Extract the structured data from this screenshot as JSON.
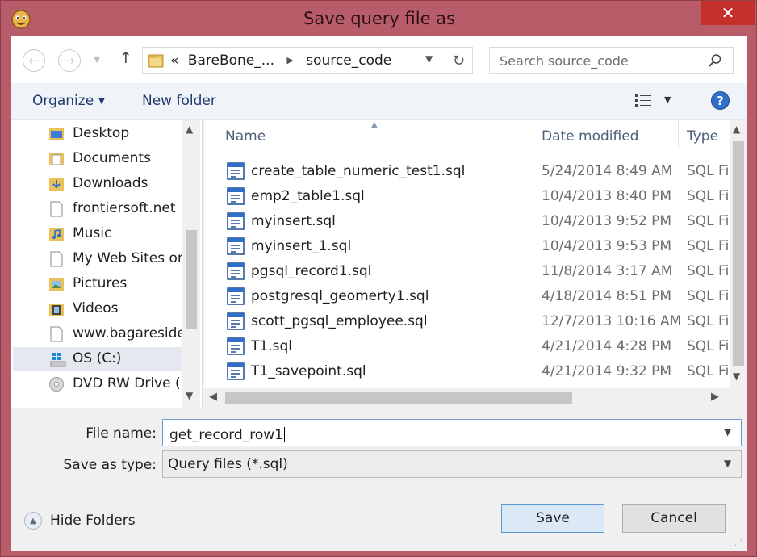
{
  "window": {
    "title": "Save query file as",
    "close_glyph": "✕",
    "app_icon": "app-icon"
  },
  "nav": {
    "back_glyph": "←",
    "forward_glyph": "→",
    "recent_glyph": "▼",
    "up_glyph": "↑",
    "address_prefix": "«",
    "breadcrumb_1": "BareBone_...",
    "breadcrumb_sep": "▶",
    "breadcrumb_2": "source_code",
    "address_drop_glyph": "▼",
    "refresh_glyph": "↻",
    "search_placeholder": "Search source_code"
  },
  "toolbar": {
    "organize": "Organize",
    "organize_caret": "▼",
    "new_folder": "New folder",
    "view_drop_glyph": "▼",
    "help": "?"
  },
  "tree": {
    "items": [
      {
        "label": "Desktop",
        "icon": "desktop-folder-icon"
      },
      {
        "label": "Documents",
        "icon": "documents-folder-icon"
      },
      {
        "label": "Downloads",
        "icon": "downloads-folder-icon"
      },
      {
        "label": "frontiersoft.net",
        "icon": "file-icon"
      },
      {
        "label": "Music",
        "icon": "music-folder-icon"
      },
      {
        "label": "My Web Sites on",
        "icon": "file-icon"
      },
      {
        "label": "Pictures",
        "icon": "pictures-folder-icon"
      },
      {
        "label": "Videos",
        "icon": "videos-folder-icon"
      },
      {
        "label": "www.bagaresider",
        "icon": "file-icon"
      },
      {
        "label": "OS (C:)",
        "icon": "windows-drive-icon",
        "selected": true
      },
      {
        "label": "DVD RW Drive (E:",
        "icon": "dvd-drive-icon"
      }
    ],
    "scroll_up_glyph": "▲",
    "scroll_down_glyph": "▼"
  },
  "files": {
    "columns": {
      "name": "Name",
      "date": "Date modified",
      "type": "Type"
    },
    "sort_glyph": "▲",
    "rows": [
      {
        "name": "create_table_numeric_test1.sql",
        "date": "5/24/2014 8:49 AM",
        "type": "SQL File"
      },
      {
        "name": "emp2_table1.sql",
        "date": "10/4/2013 8:40 PM",
        "type": "SQL File"
      },
      {
        "name": "myinsert.sql",
        "date": "10/4/2013 9:52 PM",
        "type": "SQL File"
      },
      {
        "name": "myinsert_1.sql",
        "date": "10/4/2013 9:53 PM",
        "type": "SQL File"
      },
      {
        "name": "pgsql_record1.sql",
        "date": "11/8/2014 3:17 AM",
        "type": "SQL File"
      },
      {
        "name": "postgresql_geomerty1.sql",
        "date": "4/18/2014 8:51 PM",
        "type": "SQL File"
      },
      {
        "name": "scott_pgsql_employee.sql",
        "date": "12/7/2013 10:16 AM",
        "type": "SQL File"
      },
      {
        "name": "T1.sql",
        "date": "4/21/2014 4:28 PM",
        "type": "SQL File"
      },
      {
        "name": "T1_savepoint.sql",
        "date": "4/21/2014 9:32 PM",
        "type": "SQL File"
      }
    ],
    "scroll_up_glyph": "▲",
    "scroll_down_glyph": "▼",
    "scroll_left_glyph": "◀",
    "scroll_right_glyph": "▶"
  },
  "form": {
    "file_name_label": "File name:",
    "file_name_value": "get_record_row1",
    "save_type_label": "Save as type:",
    "save_type_value": "Query files (*.sql)",
    "dropdown_glyph": "▼"
  },
  "footer": {
    "hide_folders": "Hide Folders",
    "hide_glyph": "▲",
    "save": "Save",
    "cancel": "Cancel",
    "grip_glyph": "⋰"
  },
  "colors": {
    "frame": "#b85c6a",
    "close": "#c6302b",
    "accent": "#2f6fc7",
    "default_button": "#dbe9f7"
  }
}
